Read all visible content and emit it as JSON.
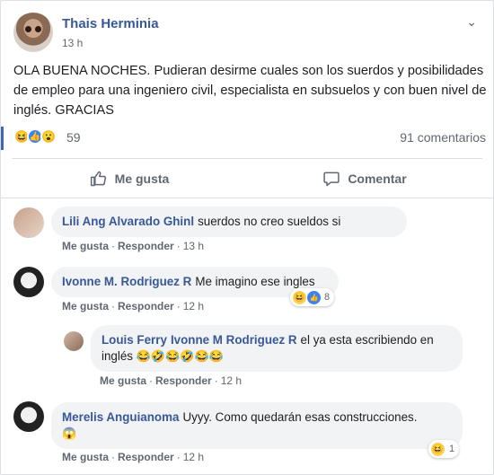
{
  "post": {
    "author": "Thais Herminia",
    "time": "13 h",
    "menu_icon": "chevron-down-icon",
    "text": "OLA BUENA NOCHES. Pudieran desirme cuales son los suerdos y posibilidades de empleo para una ingeniero civil, especialista en subsuelos y con buen nivel de inglés. GRACIAS",
    "reaction_count": "59",
    "comments_count": "91 comentarios"
  },
  "actions": {
    "like": "Me gusta",
    "comment": "Comentar"
  },
  "colors": {
    "brand": "#385898",
    "like_blue": "#4267b2",
    "meta": "#606770",
    "bubble": "#f2f3f5"
  },
  "comments": [
    {
      "author": "Lili Ang Alvarado Ghinl",
      "text": "suerdos no creo sueldos si",
      "like": "Me gusta",
      "reply": "Responder",
      "time": "13 h"
    },
    {
      "author": "Ivonne M. Rodriguez R",
      "text": "Me imagino ese ingles",
      "like": "Me gusta",
      "reply": "Responder",
      "time": "12 h",
      "reactions": "8"
    },
    {
      "author": "Louis Ferry",
      "mention": "Ivonne M Rodriguez R",
      "text": "el ya esta escribiendo en inglés",
      "emojis": "😂🤣😂🤣😂😂",
      "like": "Me gusta",
      "reply": "Responder",
      "time": "12 h"
    },
    {
      "author": "Merelis Anguianoma",
      "text": "Uyyy. Como quedarán esas construcciones.",
      "emoji": "😱",
      "like": "Me gusta",
      "reply": "Responder",
      "time": "12 h",
      "reactions": "1"
    }
  ]
}
